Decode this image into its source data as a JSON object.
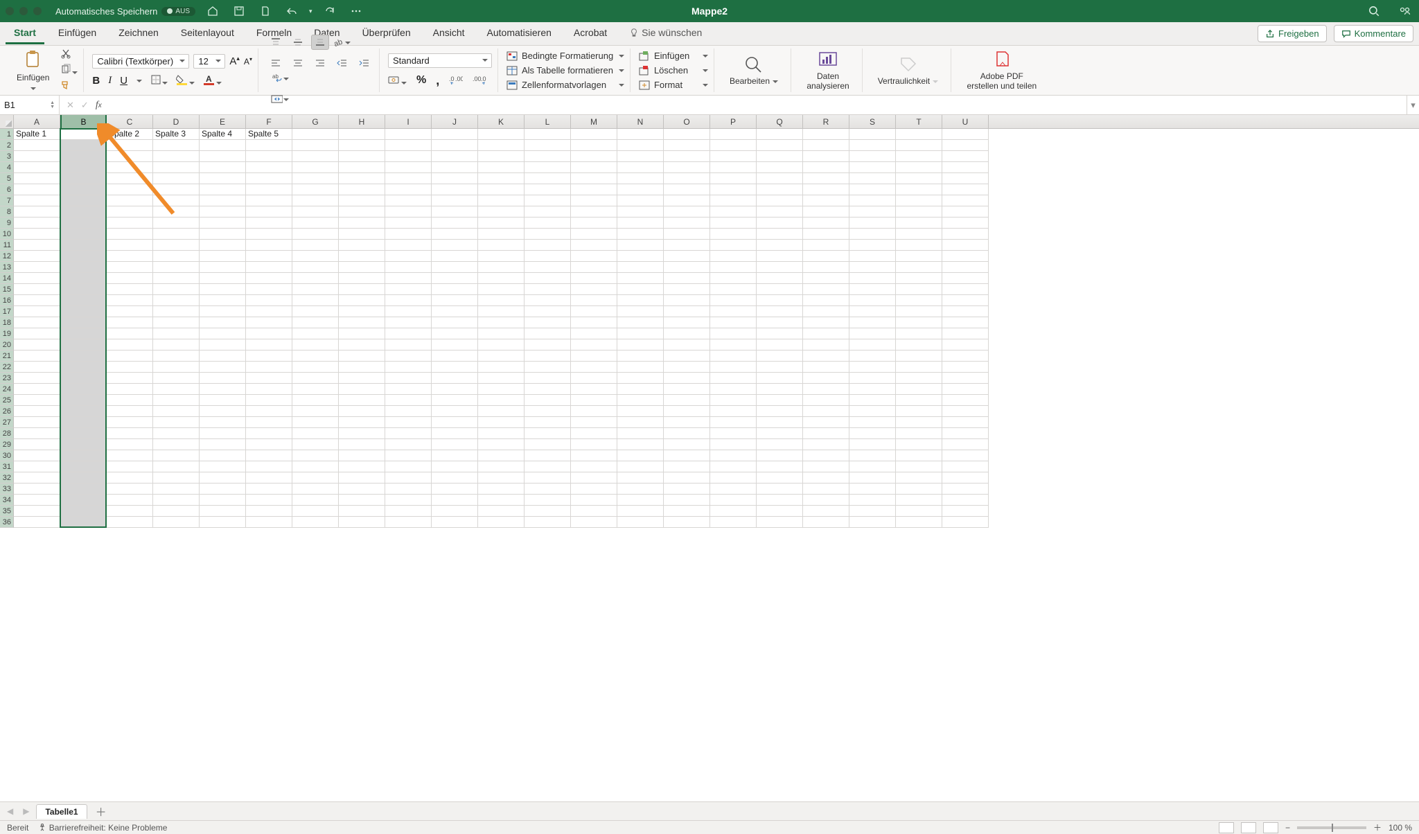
{
  "titlebar": {
    "autosave_label": "Automatisches Speichern",
    "autosave_state": "AUS",
    "title": "Mappe2"
  },
  "tabs": {
    "start": "Start",
    "einfugen": "Einfügen",
    "zeichnen": "Zeichnen",
    "seitenlayout": "Seitenlayout",
    "formeln": "Formeln",
    "daten": "Daten",
    "uberprufen": "Überprüfen",
    "ansicht": "Ansicht",
    "automatisieren": "Automatisieren",
    "acrobat": "Acrobat",
    "tell": "Sie wünschen"
  },
  "ribbon_actions": {
    "share": "Freigeben",
    "comments": "Kommentare"
  },
  "ribbon": {
    "paste_label": "Einfügen",
    "font_name": "Calibri (Textkörper)",
    "font_size": "12",
    "number_format": "Standard",
    "cond_format": "Bedingte Formatierung",
    "as_table": "Als Tabelle formatieren",
    "cell_styles": "Zellenformatvorlagen",
    "insert": "Einfügen",
    "delete": "Löschen",
    "format": "Format",
    "edit": "Bearbeiten",
    "analyze1": "Daten",
    "analyze2": "analysieren",
    "sensitivity": "Vertraulichkeit",
    "adobe1": "Adobe PDF",
    "adobe2": "erstellen und teilen"
  },
  "namebox": "B1",
  "columns": [
    "A",
    "B",
    "C",
    "D",
    "E",
    "F",
    "G",
    "H",
    "I",
    "J",
    "K",
    "L",
    "M",
    "N",
    "O",
    "P",
    "Q",
    "R",
    "S",
    "T",
    "U"
  ],
  "selected_col_index": 1,
  "row_count": 36,
  "cells": {
    "r1": [
      "Spalte 1",
      "",
      "Spalte 2",
      "Spalte 3",
      "Spalte 4",
      "Spalte 5"
    ]
  },
  "sheettab": "Tabelle1",
  "status": {
    "ready": "Bereit",
    "a11y": "Barrierefreiheit: Keine Probleme",
    "zoom": "100 %"
  }
}
